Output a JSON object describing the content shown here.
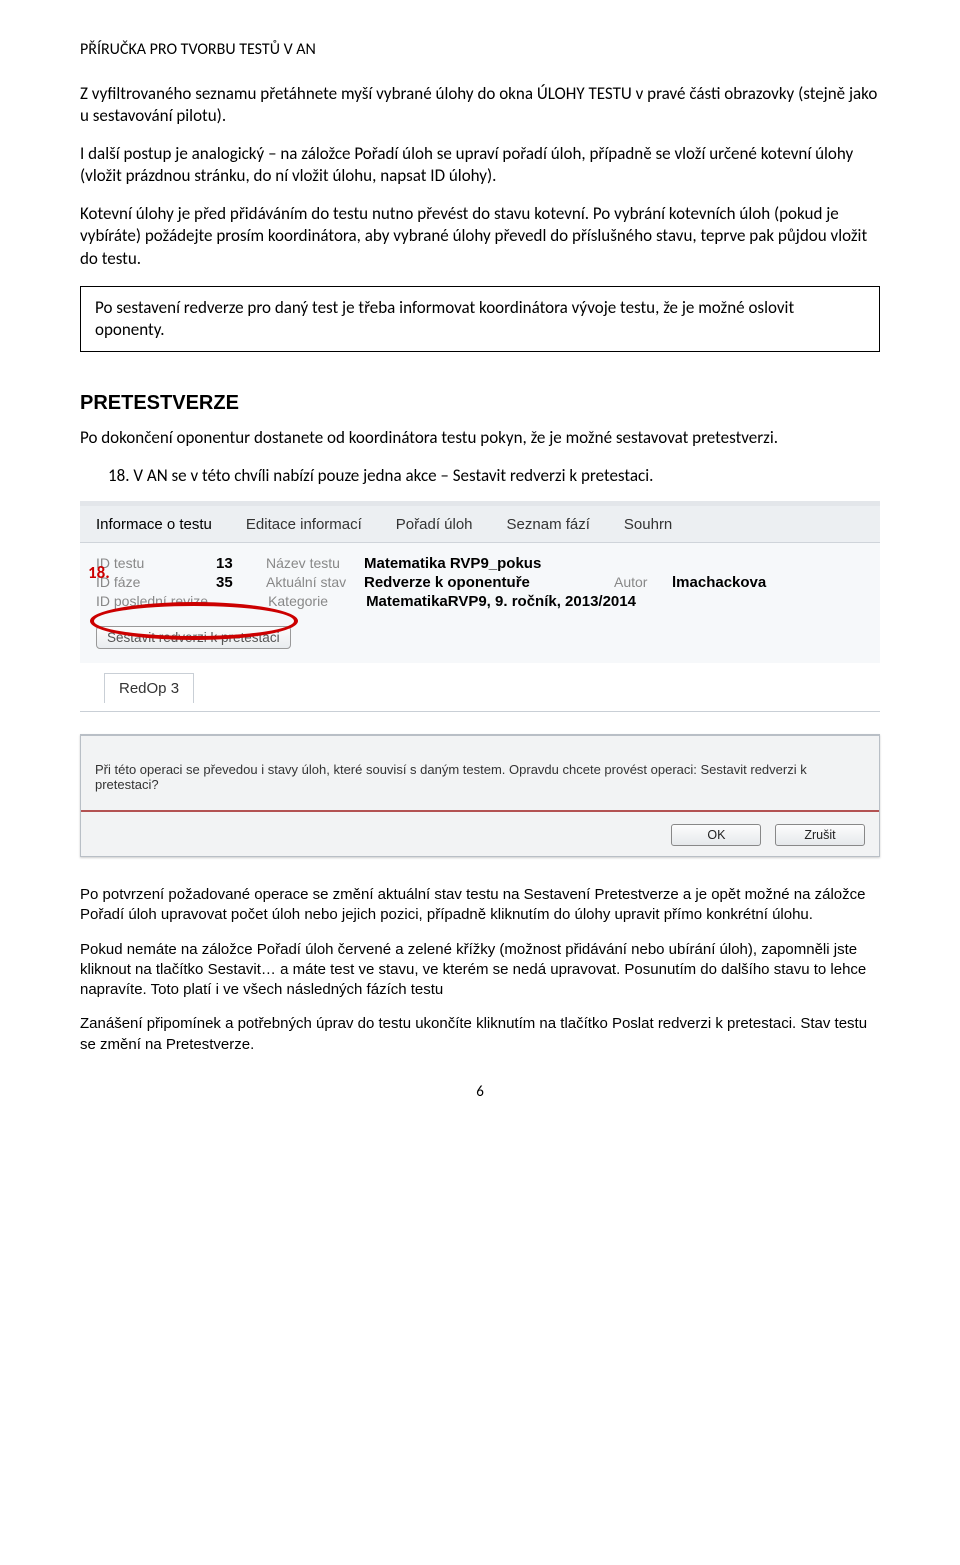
{
  "header": "PŘÍRUČKA PRO TVORBU TESTŮ V AN",
  "para1": "Z vyfiltrovaného seznamu přetáhnete myší vybrané úlohy do okna ÚLOHY TESTU v pravé části obrazovky (stejně jako u sestavování pilotu).",
  "para2": "I další postup je analogický – na záložce Pořadí úloh se upraví pořadí úloh, případně se vloží určené kotevní úlohy (vložit prázdnou stránku, do ní vložit úlohu, napsat ID úlohy).",
  "para3": "Kotevní úlohy je před přidáváním do testu nutno převést do stavu kotevní. Po vybrání kotevních úloh (pokud je vybíráte) požádejte prosím koordinátora, aby vybrané úlohy převedl do příslušného stavu, teprve pak půjdou vložit do testu.",
  "boxtext": "Po sestavení redverze pro daný test je třeba informovat koordinátora vývoje testu, že je možné oslovit oponenty.",
  "h2": "PRETESTVERZE",
  "para4": "Po dokončení oponentur dostanete od koordinátora testu pokyn, že je možné sestavovat pretestverzi.",
  "item18": "18. V AN se v této chvíli nabízí pouze jedna akce – Sestavit redverzi k pretestaci.",
  "step18label": "18.",
  "tabs": {
    "info": "Informace o testu",
    "edit": "Editace informací",
    "poradi": "Pořadí úloh",
    "fazi": "Seznam fází",
    "souhrn": "Souhrn"
  },
  "labels": {
    "idtestu": "ID testu",
    "idfaze": "ID fáze",
    "idrev": "ID poslední revize",
    "nazev": "Název testu",
    "stav": "Aktuální stav",
    "kategorie": "Kategorie",
    "autor": "Autor"
  },
  "values": {
    "idtestu": "13",
    "idfaze": "35",
    "nazev": "Matematika RVP9_pokus",
    "stav": "Redverze k oponentuře",
    "kategorie": "MatematikaRVP9, 9. ročník, 2013/2014",
    "autor": "lmachackova"
  },
  "actionbtn": "Sestavit redverzi k pretestaci",
  "subtab": "RedOp 3",
  "dialog": {
    "msg": "Při této operaci se převedou i stavy úloh, které souvisí s daným testem. Opravdu chcete provést operaci: Sestavit redverzi k pretestaci?",
    "ok": "OK",
    "cancel": "Zrušit"
  },
  "para5": "Po potvrzení požadované operace se změní aktuální stav testu na Sestavení Pretestverze a je opět možné na záložce Pořadí úloh upravovat počet úloh nebo jejich pozici, případně kliknutím do úlohy upravit přímo konkrétní úlohu.",
  "para6": "Pokud nemáte na záložce Pořadí úloh červené a zelené křížky (možnost přidávání nebo ubírání úloh), zapomněli jste kliknout na tlačítko Sestavit… a máte test ve stavu, ve kterém se nedá upravovat. Posunutím do dalšího stavu to lehce napravíte.  Toto platí i ve všech následných fázích testu",
  "para7": "Zanášení připomínek a potřebných úprav do testu ukončíte kliknutím na tlačítko  Poslat redverzi k pretestaci. Stav testu se změní na Pretestverze.",
  "pagenum": "6"
}
